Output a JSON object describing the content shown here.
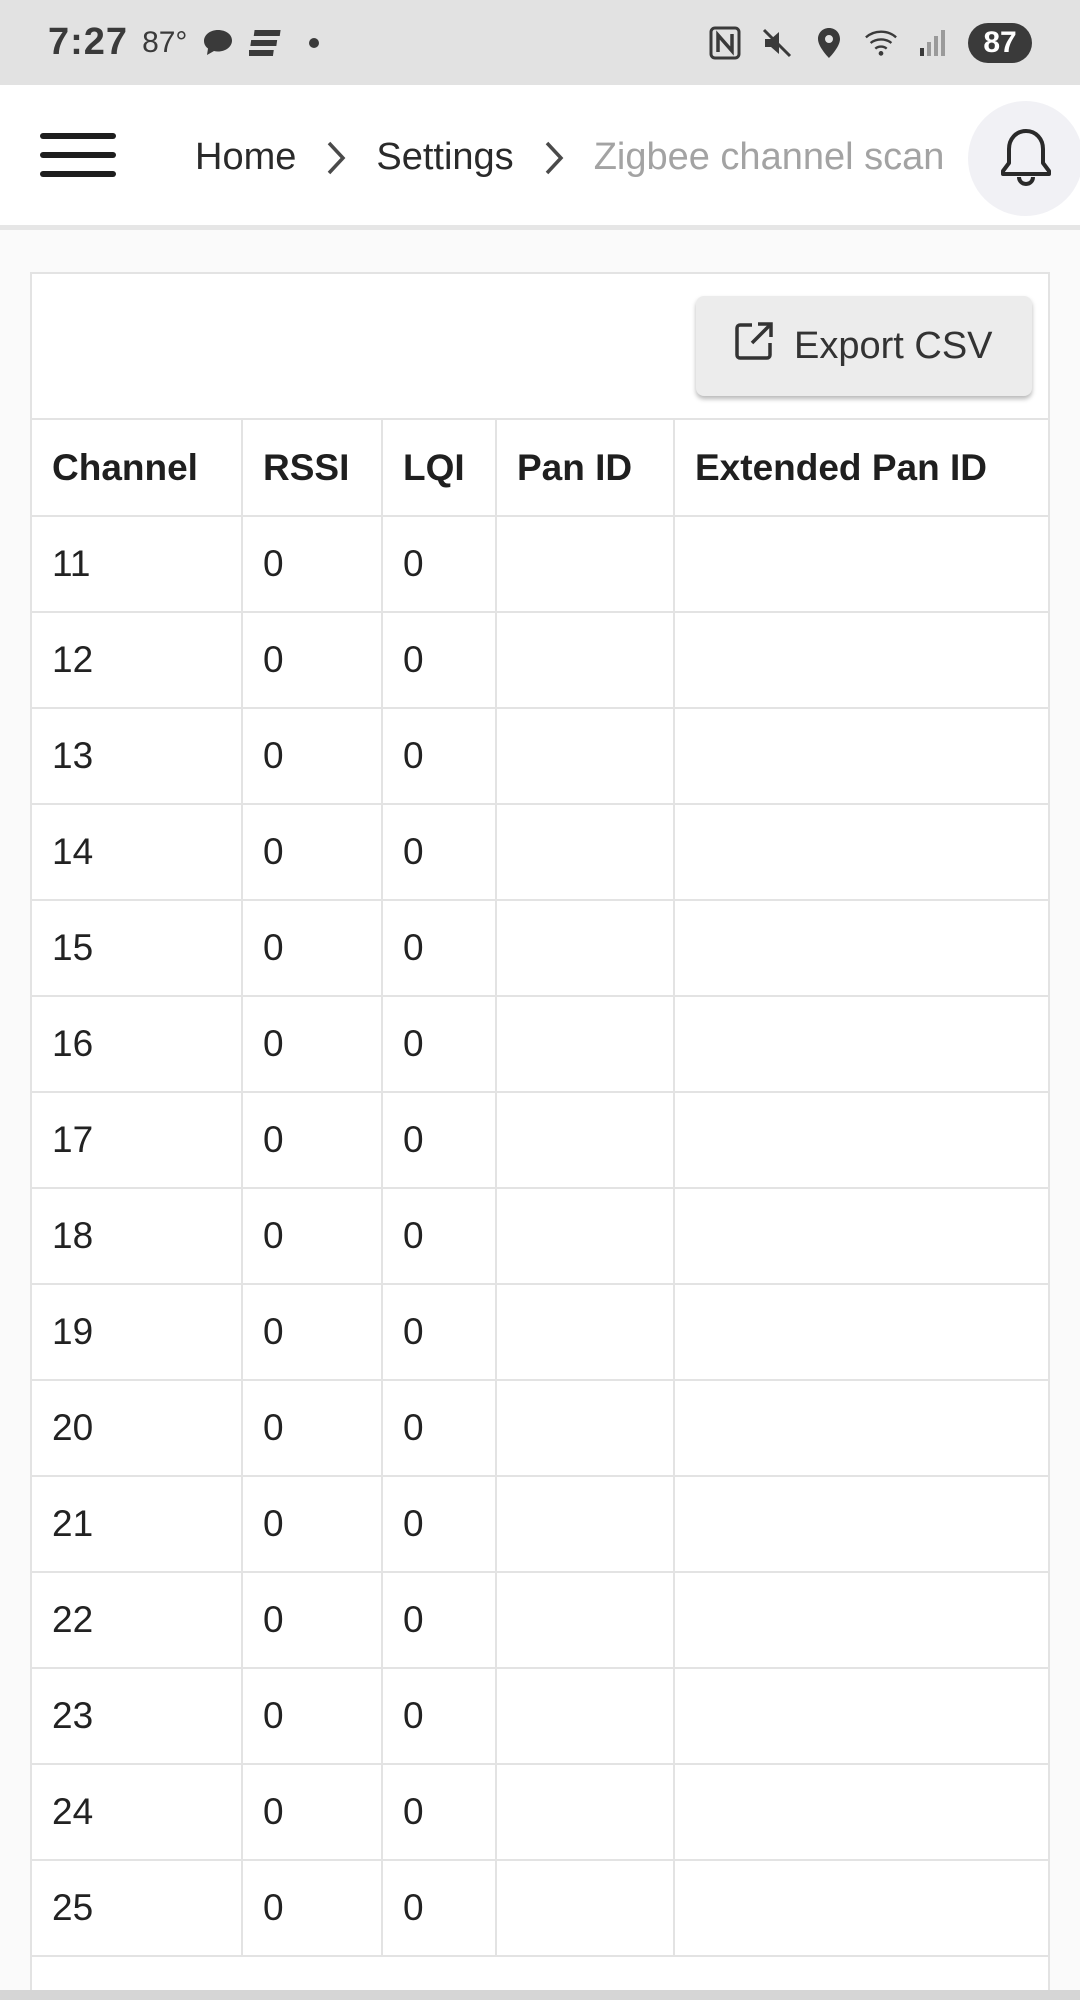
{
  "status_bar": {
    "time": "7:27",
    "temperature": "87°",
    "battery": "87"
  },
  "app_bar": {
    "breadcrumb": [
      "Home",
      "Settings",
      "Zigbee channel scan"
    ]
  },
  "toolbar": {
    "export_label": "Export CSV"
  },
  "table": {
    "headers": [
      "Channel",
      "RSSI",
      "LQI",
      "Pan ID",
      "Extended Pan ID"
    ],
    "rows": [
      [
        "11",
        "0",
        "0",
        "",
        ""
      ],
      [
        "12",
        "0",
        "0",
        "",
        ""
      ],
      [
        "13",
        "0",
        "0",
        "",
        ""
      ],
      [
        "14",
        "0",
        "0",
        "",
        ""
      ],
      [
        "15",
        "0",
        "0",
        "",
        ""
      ],
      [
        "16",
        "0",
        "0",
        "",
        ""
      ],
      [
        "17",
        "0",
        "0",
        "",
        ""
      ],
      [
        "18",
        "0",
        "0",
        "",
        ""
      ],
      [
        "19",
        "0",
        "0",
        "",
        ""
      ],
      [
        "20",
        "0",
        "0",
        "",
        ""
      ],
      [
        "21",
        "0",
        "0",
        "",
        ""
      ],
      [
        "22",
        "0",
        "0",
        "",
        ""
      ],
      [
        "23",
        "0",
        "0",
        "",
        ""
      ],
      [
        "24",
        "0",
        "0",
        "",
        ""
      ],
      [
        "25",
        "0",
        "0",
        "",
        ""
      ]
    ]
  },
  "colors": {
    "status_bar_bg": "#e2e2e2",
    "app_bar_bg": "#ffffff",
    "page_bg": "#fafafa",
    "breadcrumb_current": "#a3a3a3",
    "button_bg": "#ececec"
  },
  "icons": {
    "menu": "menu-icon",
    "breadcrumb_separator": "chevron-right-icon",
    "notifications": "bell-icon",
    "export": "open-in-new-icon"
  }
}
